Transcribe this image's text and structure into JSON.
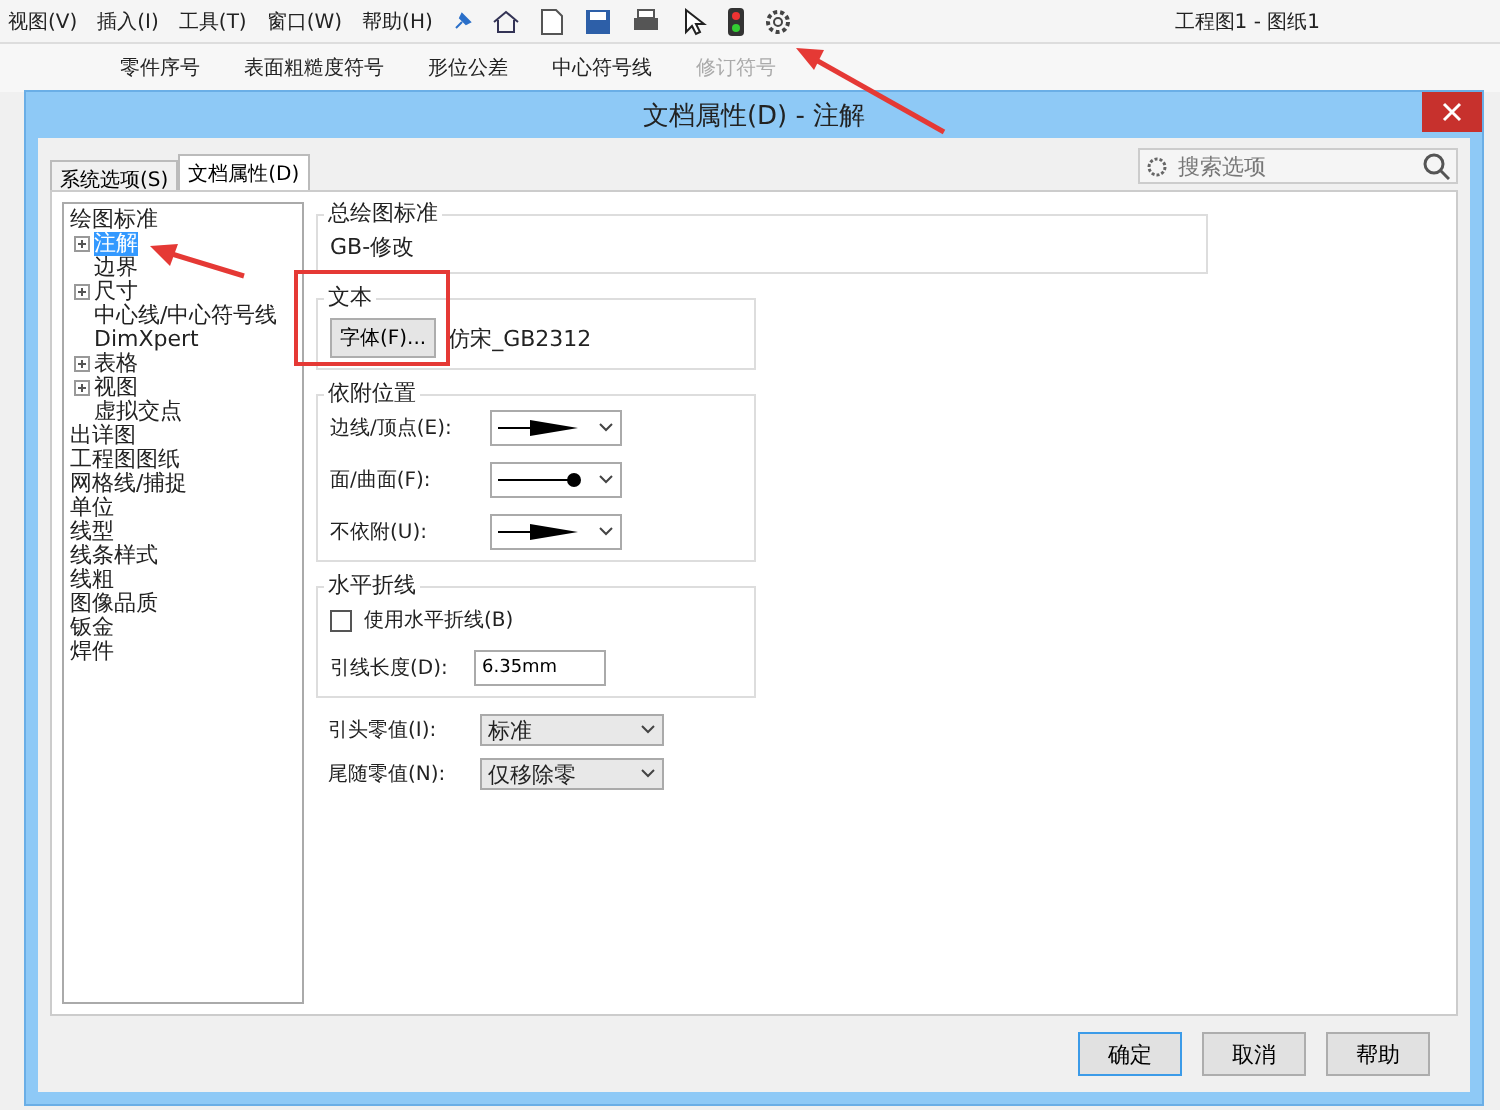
{
  "app": {
    "menu": [
      "视图(V)",
      "插入(I)",
      "工具(T)",
      "窗口(W)",
      "帮助(H)"
    ],
    "title": "工程图1 - 图纸1",
    "ribbon": [
      {
        "label": "零件序号",
        "disabled": false
      },
      {
        "label": "表面粗糙度符号",
        "disabled": false
      },
      {
        "label": "形位公差",
        "disabled": false
      },
      {
        "label": "中心符号线",
        "disabled": false
      },
      {
        "label": "修订符号",
        "disabled": true
      }
    ]
  },
  "dialog": {
    "title": "文档属性(D) - 注解",
    "tabs": [
      {
        "label": "系统选项(S)",
        "selected": false
      },
      {
        "label": "文档属性(D)",
        "selected": true
      }
    ],
    "search": {
      "placeholder": "搜索选项"
    },
    "tree": [
      {
        "label": "绘图标准",
        "selected": false,
        "children": [
          {
            "label": "注解",
            "selected": true,
            "expandable": true
          },
          {
            "label": "边界",
            "selected": false,
            "expandable": false
          },
          {
            "label": "尺寸",
            "selected": false,
            "expandable": true
          },
          {
            "label": "中心线/中心符号线",
            "selected": false,
            "expandable": false
          },
          {
            "label": "DimXpert",
            "selected": false,
            "expandable": false
          },
          {
            "label": "表格",
            "selected": false,
            "expandable": true
          },
          {
            "label": "视图",
            "selected": false,
            "expandable": true
          },
          {
            "label": "虚拟交点",
            "selected": false,
            "expandable": false
          }
        ]
      },
      {
        "label": "出详图",
        "selected": false
      },
      {
        "label": "工程图图纸",
        "selected": false
      },
      {
        "label": "网格线/捕捉",
        "selected": false
      },
      {
        "label": "单位",
        "selected": false
      },
      {
        "label": "线型",
        "selected": false
      },
      {
        "label": "线条样式",
        "selected": false
      },
      {
        "label": "线粗",
        "selected": false
      },
      {
        "label": "图像品质",
        "selected": false
      },
      {
        "label": "钣金",
        "selected": false
      },
      {
        "label": "焊件",
        "selected": false
      }
    ],
    "standard": {
      "heading": "总绘图标准",
      "value": "GB-修改"
    },
    "text": {
      "heading": "文本",
      "button": "字体(F)...",
      "font": "仿宋_GB2312"
    },
    "attachment": {
      "heading": "依附位置",
      "rows": [
        {
          "label": "边线/顶点(E):",
          "kind": "arrow"
        },
        {
          "label": "面/曲面(F):",
          "kind": "dot"
        },
        {
          "label": "不依附(U):",
          "kind": "arrow"
        }
      ]
    },
    "bent_leader": {
      "heading": "水平折线",
      "checkbox": {
        "label": "使用水平折线(B)",
        "checked": false
      },
      "length": {
        "label": "引线长度(D):",
        "value": "6.35mm"
      }
    },
    "zeros": [
      {
        "label": "引头零值(I):",
        "value": "标准"
      },
      {
        "label": "尾随零值(N):",
        "value": "仅移除零"
      }
    ],
    "buttons": [
      {
        "label": "确定",
        "selected": true
      },
      {
        "label": "取消",
        "selected": false
      },
      {
        "label": "帮助",
        "selected": false
      }
    ]
  }
}
